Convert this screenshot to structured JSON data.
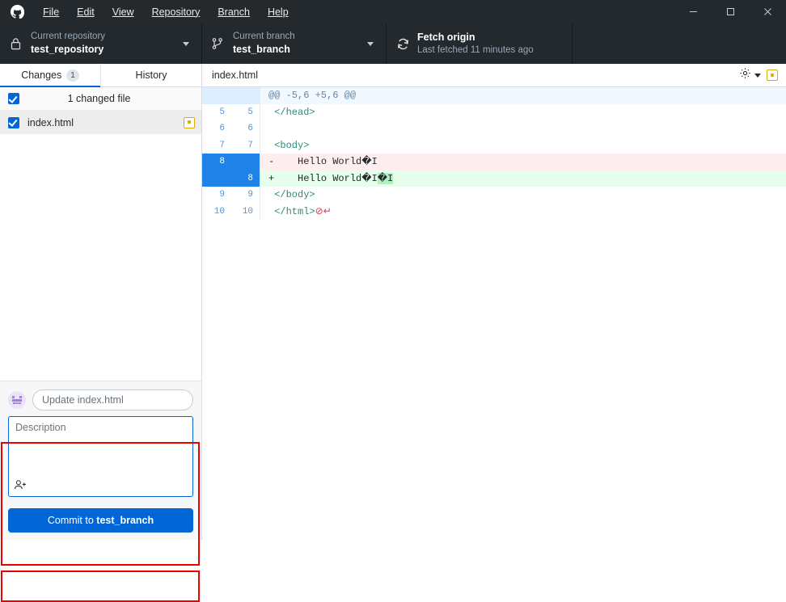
{
  "window": {
    "minimize_label": "minimize-icon",
    "maximize_label": "maximize-icon",
    "close_label": "close-icon"
  },
  "menu": {
    "items": [
      {
        "label": "File",
        "mnemonic": "F"
      },
      {
        "label": "Edit",
        "mnemonic": "E"
      },
      {
        "label": "View",
        "mnemonic": "V"
      },
      {
        "label": "Repository",
        "mnemonic": "R"
      },
      {
        "label": "Branch",
        "mnemonic": "B"
      },
      {
        "label": "Help",
        "mnemonic": "H"
      }
    ]
  },
  "toolbar": {
    "repository": {
      "caption": "Current repository",
      "value": "test_repository",
      "icon": "lock-icon"
    },
    "branch": {
      "caption": "Current branch",
      "value": "test_branch",
      "icon": "git-branch-icon"
    },
    "fetch": {
      "title": "Fetch origin",
      "subtitle": "Last fetched 11 minutes ago",
      "icon": "sync-icon"
    }
  },
  "sidebar": {
    "tabs": [
      {
        "label": "Changes",
        "count": "1",
        "active": true
      },
      {
        "label": "History",
        "count": "",
        "active": false
      }
    ],
    "changed_summary": "1 changed file",
    "files": [
      {
        "name": "index.html",
        "status": "modified",
        "checked": true,
        "selected": true
      }
    ]
  },
  "commit": {
    "summary_value": "",
    "summary_placeholder": "Update index.html",
    "description_value": "",
    "description_placeholder": "Description",
    "coauthor_icon": "person-add-icon",
    "avatar_icon": "avatar-identicon",
    "button_prefix": "Commit to ",
    "button_branch": "test_branch"
  },
  "diff": {
    "filename": "index.html",
    "settings_icon": "gear-icon",
    "settings_caret": "chevron-down-icon",
    "status_badge": "modified-badge",
    "lines": [
      {
        "type": "hunk",
        "old": "",
        "new": "",
        "marker": "",
        "text": "@@ -5,6 +5,6 @@"
      },
      {
        "type": "ctx",
        "old": "5",
        "new": "5",
        "marker": " ",
        "text": "</head>"
      },
      {
        "type": "ctx",
        "old": "6",
        "new": "6",
        "marker": " ",
        "text": ""
      },
      {
        "type": "ctx",
        "old": "7",
        "new": "7",
        "marker": " ",
        "text": "<body>"
      },
      {
        "type": "del",
        "old": "8",
        "new": "",
        "marker": "-",
        "text": "    Hello World�I"
      },
      {
        "type": "add",
        "old": "",
        "new": "8",
        "marker": "+",
        "text": "    Hello World�I�I",
        "highlight": "�I"
      },
      {
        "type": "ctx",
        "old": "9",
        "new": "9",
        "marker": " ",
        "text": "</body>"
      },
      {
        "type": "ctx",
        "old": "10",
        "new": "10",
        "marker": " ",
        "text": "</html>",
        "no_newline": "⊘",
        "crlf": "↵"
      }
    ]
  },
  "colors": {
    "header_bg": "#24292e",
    "accent_blue": "#0366d6",
    "selected_gutter": "#1f83e8",
    "add_bg": "#e6ffed",
    "del_bg": "#ffeef0",
    "hunk_bg": "#f1f8ff",
    "modified_yellow": "#dbab09",
    "annotation_red": "#ee0000",
    "tag_color": "#2e8b7a"
  }
}
